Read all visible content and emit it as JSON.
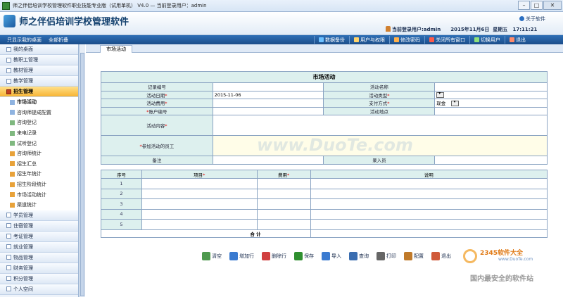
{
  "window": {
    "title": "师之伴侣培训学校管理软件职业技能专业版（试用单机） V4.0 —  当前登录用户：admin",
    "buttons": [
      "–",
      "□",
      "✕"
    ]
  },
  "header": {
    "app_name": "师之伴侣培训学校管理软件",
    "about": "关于软件",
    "user_label": "当前登录用户:admin",
    "date": "2015年11月6日",
    "weekday": "星期五",
    "time": "17:11:21"
  },
  "toolbar": {
    "left_links": [
      "只显示我的桌面",
      "全部折叠"
    ],
    "items": [
      {
        "label": "数据备份",
        "icon": "database-icon",
        "color": "#6cc0ff"
      },
      {
        "label": "用户与权限",
        "icon": "users-icon",
        "color": "#ffd36b"
      },
      {
        "label": "修改密码",
        "icon": "key-icon",
        "color": "#ffb04a"
      },
      {
        "label": "关闭所有窗口",
        "icon": "close-windows-icon",
        "color": "#ff5a4a"
      },
      {
        "label": "切换用户",
        "icon": "switch-user-icon",
        "color": "#8fe07a"
      },
      {
        "label": "退出",
        "icon": "exit-icon",
        "color": "#ff8a6a"
      }
    ]
  },
  "sidebar": {
    "groups_top": [
      "我的桌面",
      "教职工管理",
      "教材管理",
      "教学管理"
    ],
    "active_group": "招生管理",
    "sub_items": [
      {
        "label": "市场活动",
        "icon": "doc-icon",
        "color": "#8fb3e0"
      },
      {
        "label": "咨询师提成配置",
        "icon": "doc-icon",
        "color": "#8fb3e0"
      },
      {
        "label": "咨询登记",
        "icon": "note-icon",
        "color": "#7fb87f"
      },
      {
        "label": "来电记录",
        "icon": "note-icon",
        "color": "#7fb87f"
      },
      {
        "label": "试听登记",
        "icon": "note-icon",
        "color": "#7fb87f"
      },
      {
        "label": "咨询师统计",
        "icon": "bar-chart-icon",
        "color": "#e8a23a"
      },
      {
        "label": "招生汇总",
        "icon": "bar-chart-icon",
        "color": "#e8a23a"
      },
      {
        "label": "招生年统计",
        "icon": "bar-chart-icon",
        "color": "#e8a23a"
      },
      {
        "label": "招生阶段统计",
        "icon": "bar-chart-icon",
        "color": "#e8a23a"
      },
      {
        "label": "市场活动统计",
        "icon": "bar-chart-icon",
        "color": "#e8a23a"
      },
      {
        "label": "渠道统计",
        "icon": "bar-chart-icon",
        "color": "#e8a23a"
      }
    ],
    "groups_bottom": [
      "学员管理",
      "住宿管理",
      "考证管理",
      "就业管理",
      "物品管理",
      "财务管理",
      "积分管理",
      "个人空间"
    ]
  },
  "tab": {
    "label": "市场活动"
  },
  "form": {
    "caption": "市场活动",
    "record_no_label": "记录编号",
    "activity_name_label": "活动名称",
    "date_label": "活动日期",
    "date_value": "2015-11-06",
    "type_label": "活动类型",
    "cost_label": "活动费用",
    "payment_label": "支付方式",
    "payment_value": "现金",
    "account_label": "账户编号",
    "location_label": "活动地点",
    "content_label": "活动内容",
    "staff_label": "参加活动的员工",
    "remark_label": "备注",
    "entry_label": "录入员",
    "required_mark": "*"
  },
  "grid": {
    "headers": [
      "序号",
      "项目",
      "费用",
      "说明"
    ],
    "rows": [
      "1",
      "2",
      "3",
      "4",
      "5"
    ],
    "total_label": "合  计"
  },
  "buttons": [
    {
      "label": "清空",
      "icon": "clear-icon",
      "color": "#4f9a4f"
    },
    {
      "label": "增加行",
      "icon": "add-row-icon",
      "color": "#3b7bd0"
    },
    {
      "label": "删除行",
      "icon": "delete-row-icon",
      "color": "#d04040"
    },
    {
      "label": "保存",
      "icon": "save-icon",
      "color": "#2f8f2f"
    },
    {
      "label": "导入",
      "icon": "import-icon",
      "color": "#3b7bd0"
    },
    {
      "label": "查询",
      "icon": "search-icon",
      "color": "#3a6db0"
    },
    {
      "label": "打印",
      "icon": "print-icon",
      "color": "#666666"
    },
    {
      "label": "配置",
      "icon": "settings-icon",
      "color": "#c07a2a"
    },
    {
      "label": "退出",
      "icon": "exit-icon",
      "color": "#d05a3a"
    }
  ],
  "watermark": {
    "text": "www.DuoTe.com",
    "badge": "2345软件大全",
    "badge_url": "www.DuoTe.com",
    "slogan": "国内最安全的软件站"
  }
}
